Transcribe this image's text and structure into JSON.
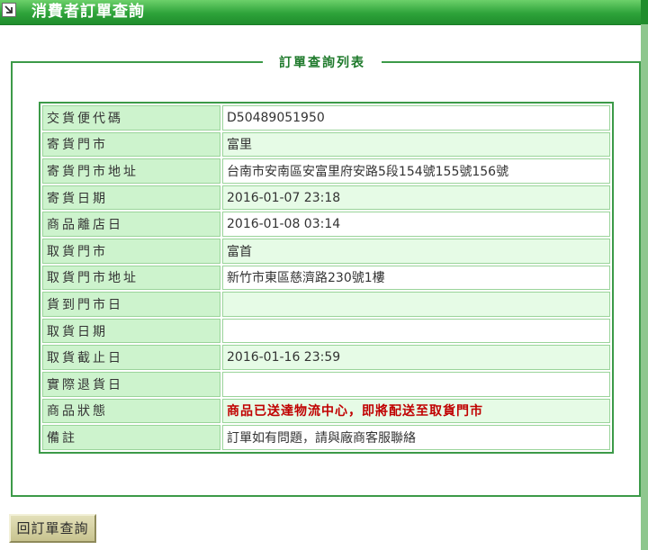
{
  "header": {
    "title": "消費者訂單查詢"
  },
  "panel": {
    "legend": "訂單查詢列表"
  },
  "rows": [
    {
      "label": "交貨便代碼",
      "value": "D50489051950"
    },
    {
      "label": "寄貨門市",
      "value": "富里"
    },
    {
      "label": "寄貨門市地址",
      "value": "台南市安南區安富里府安路5段154號155號156號"
    },
    {
      "label": "寄貨日期",
      "value": "2016-01-07 23:18"
    },
    {
      "label": "商品離店日",
      "value": "2016-01-08 03:14"
    },
    {
      "label": "取貨門市",
      "value": "富首"
    },
    {
      "label": "取貨門市地址",
      "value": "新竹市東區慈濟路230號1樓"
    },
    {
      "label": "貨到門市日",
      "value": ""
    },
    {
      "label": "取貨日期",
      "value": ""
    },
    {
      "label": "取貨截止日",
      "value": "2016-01-16 23:59"
    },
    {
      "label": "實際退貨日",
      "value": ""
    },
    {
      "label": "商品狀態",
      "value": "商品已送達物流中心，即將配送至取貨門市"
    },
    {
      "label": "備註",
      "value": "訂單如有問題，請與廠商客服聯絡"
    }
  ],
  "buttons": {
    "back_label": "回訂單查詢"
  },
  "colors": {
    "header_green": "#2ea33a",
    "label_bg": "#cdf3cd",
    "alert_red": "#c00000"
  }
}
